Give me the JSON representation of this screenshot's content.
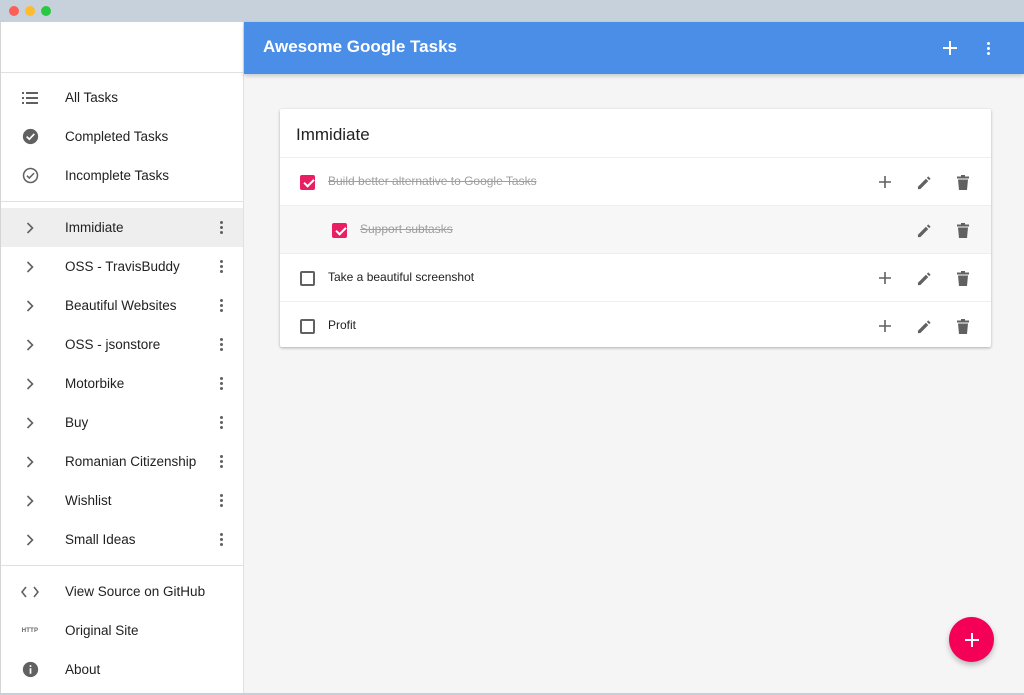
{
  "app": {
    "title": "Awesome Google Tasks",
    "accent": "#4a8ee7",
    "fab_color": "#f50057",
    "check_color": "#e91e63"
  },
  "appbar": {
    "add_icon": "plus-icon",
    "more_icon": "more-vert-icon"
  },
  "sidebar": {
    "filters": [
      {
        "label": "All Tasks",
        "icon": "list-icon"
      },
      {
        "label": "Completed Tasks",
        "icon": "check-circle-filled-icon"
      },
      {
        "label": "Incomplete Tasks",
        "icon": "check-circle-outline-icon"
      }
    ],
    "lists": [
      {
        "label": "Immidiate",
        "active": true
      },
      {
        "label": "OSS - TravisBuddy"
      },
      {
        "label": "Beautiful Websites"
      },
      {
        "label": "OSS - jsonstore"
      },
      {
        "label": "Motorbike"
      },
      {
        "label": "Buy"
      },
      {
        "label": "Romanian Citizenship"
      },
      {
        "label": "Wishlist"
      },
      {
        "label": "Small Ideas"
      }
    ],
    "links": [
      {
        "label": "View Source on GitHub",
        "icon": "code-icon"
      },
      {
        "label": "Original Site",
        "icon": "http-icon",
        "icon_text": "HTTP"
      },
      {
        "label": "About",
        "icon": "info-icon"
      }
    ]
  },
  "card": {
    "title": "Immidiate",
    "tasks": [
      {
        "text": "Build better alternative to Google Tasks",
        "completed": true,
        "subtask": false
      },
      {
        "text": "Support subtasks",
        "completed": true,
        "subtask": true
      },
      {
        "text": "Take a beautiful screenshot",
        "completed": false,
        "subtask": false
      },
      {
        "text": "Profit",
        "completed": false,
        "subtask": false
      }
    ]
  }
}
